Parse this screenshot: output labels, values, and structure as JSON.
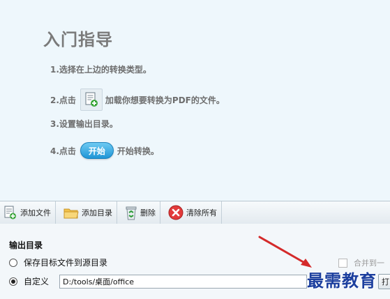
{
  "guide": {
    "title": "入门指导",
    "step1": "1.选择在上边的转换类型。",
    "step2_prefix": "2.点击",
    "step2_suffix": "加载你想要转换为PDF的文件。",
    "step3": "3.设置输出目录。",
    "step4_prefix": "4.点击",
    "step4_button": "开始",
    "step4_suffix": "开始转换。"
  },
  "toolbar": {
    "add_file": "添加文件",
    "add_folder": "添加目录",
    "delete": "删除",
    "clear_all": "清除所有"
  },
  "output": {
    "title": "输出目录",
    "option_source": "保存目标文件到源目录",
    "option_custom": "自定义",
    "custom_path": "D:/tools/桌面/office",
    "merge_label": "合并到一",
    "browse_label": "打"
  },
  "watermark": "最需教育"
}
